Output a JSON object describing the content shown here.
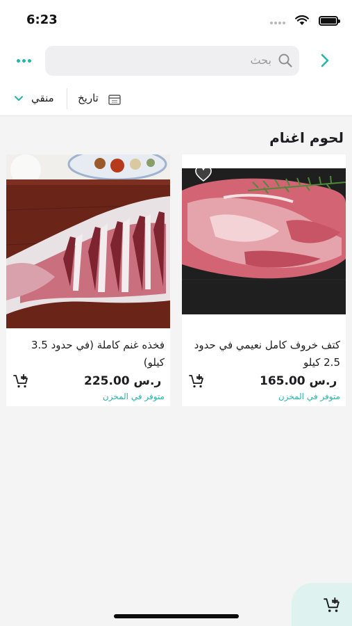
{
  "status_bar": {
    "time": "6:23"
  },
  "header": {
    "search_placeholder": "بحث",
    "icons": {
      "more": "more-dots-icon",
      "search": "search-icon",
      "back": "chevron-right-icon"
    }
  },
  "filters": {
    "sort_label": "منقي",
    "date_label": "تاريخ",
    "icons": {
      "sort": "chevron-down-icon",
      "date": "calendar-icon"
    }
  },
  "section": {
    "title": "لحوم اغنام"
  },
  "products": [
    {
      "name": "كتف خروف كامل نعيمي في حدود 2.5 كيلو",
      "price": "ر.س 165.00",
      "stock": "متوفر في المخزن"
    },
    {
      "name": "فخذه غنم كاملة (في حدود 3.5 كيلو)",
      "price": "ر.س 225.00",
      "stock": "متوفر في المخزن"
    }
  ],
  "colors": {
    "accent": "#25b5a9",
    "floating_cart_bg": "#def3f0",
    "page_bg": "#f4f4f5"
  }
}
